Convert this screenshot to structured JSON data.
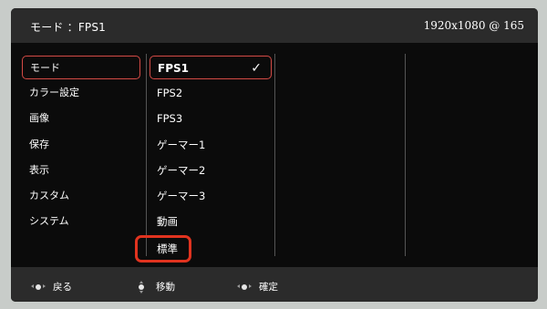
{
  "header": {
    "title": "モード ：FPS1",
    "resolution": "1920x1080 @ 165"
  },
  "menu": {
    "items": [
      {
        "label": "モード"
      },
      {
        "label": "カラー設定"
      },
      {
        "label": "画像"
      },
      {
        "label": "保存"
      },
      {
        "label": "表示"
      },
      {
        "label": "カスタム"
      },
      {
        "label": "システム"
      }
    ],
    "selected": "モード"
  },
  "modes": {
    "items": [
      {
        "label": "FPS1"
      },
      {
        "label": "FPS2"
      },
      {
        "label": "FPS3"
      },
      {
        "label": "ゲーマー1"
      },
      {
        "label": "ゲーマー2"
      },
      {
        "label": "ゲーマー3"
      },
      {
        "label": "動画"
      },
      {
        "label": "標準"
      }
    ],
    "current": "FPS1",
    "check_icon": "check-icon"
  },
  "footer": {
    "back": "戻る",
    "move": "移動",
    "confirm": "確定"
  },
  "colors": {
    "highlight": "#e1331f",
    "selection": "#d44a45",
    "panel": "#0b0b0b",
    "bar": "#2b2b2b"
  }
}
